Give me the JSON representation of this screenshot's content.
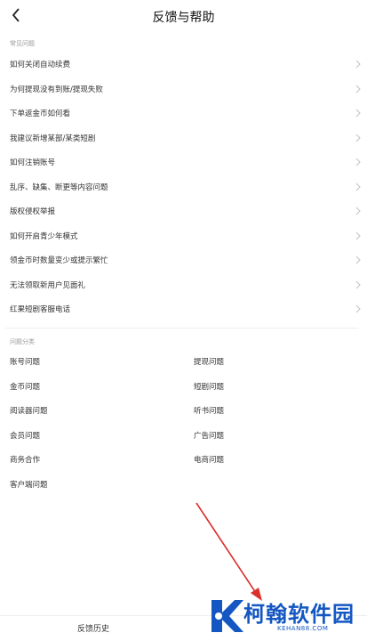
{
  "header": {
    "title": "反馈与帮助",
    "back_icon": "chevron-left-icon"
  },
  "faq": {
    "section_label": "常见问题",
    "items": [
      "如何关闭自动续费",
      "为何提现没有到账/提现失败",
      "下单返金币如何看",
      "我建议新增某部/某类短剧",
      "如何注销账号",
      "乱序、缺集、断更等内容问题",
      "版权侵权举报",
      "如何开启青少年模式",
      "领金币时数量变少或提示繁忙",
      "无法领取新用户见面礼",
      "红果短剧客服电话"
    ]
  },
  "categories": {
    "section_label": "问题分类",
    "left": [
      "账号问题",
      "金币问题",
      "阅读器问题",
      "会员问题",
      "商务合作",
      "客户端问题"
    ],
    "right": [
      "提现问题",
      "短剧问题",
      "听书问题",
      "广告问题",
      "电商问题"
    ]
  },
  "bottom": {
    "history_label": "反馈历史"
  },
  "watermark": {
    "title": "柯翰软件园",
    "url": "KEHAN88.COM"
  },
  "colors": {
    "annotation_arrow": "#d9302c",
    "watermark": "#1457c2"
  }
}
